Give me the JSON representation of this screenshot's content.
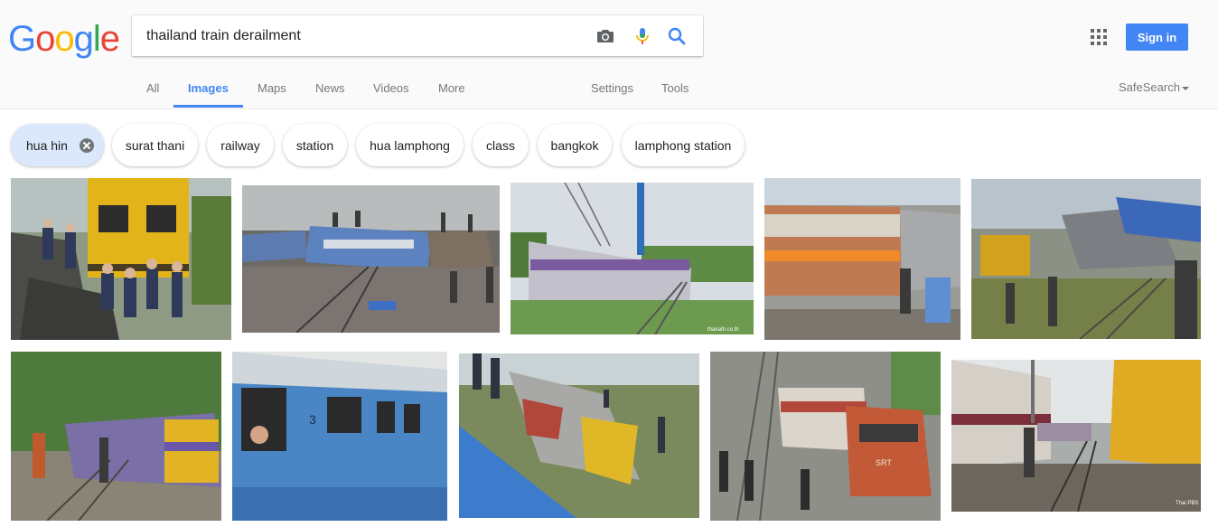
{
  "logo": {
    "letters": [
      "G",
      "o",
      "o",
      "g",
      "l",
      "e"
    ],
    "colors": [
      "#4285f4",
      "#ea4335",
      "#fbbc05",
      "#4285f4",
      "#34a853",
      "#ea4335"
    ]
  },
  "search": {
    "query": "thailand train derailment",
    "camera_icon": "camera-icon",
    "mic_icon": "mic-icon",
    "search_icon": "search-icon"
  },
  "header": {
    "apps_icon": "apps-grid-icon",
    "sign_in_label": "Sign in",
    "accent": "#4285f4"
  },
  "tabs": {
    "all": "All",
    "images": "Images",
    "maps": "Maps",
    "news": "News",
    "videos": "Videos",
    "more": "More",
    "settings": "Settings",
    "tools": "Tools",
    "active": "Images"
  },
  "safesearch": {
    "label": "SafeSearch"
  },
  "chips": [
    {
      "label": "hua hin",
      "selected": true
    },
    {
      "label": "surat thani"
    },
    {
      "label": "railway"
    },
    {
      "label": "station"
    },
    {
      "label": "hua lamphong"
    },
    {
      "label": "class"
    },
    {
      "label": "bangkok"
    },
    {
      "label": "lamphong station"
    }
  ],
  "results": {
    "thumbnails": [
      {
        "subject": "yellow locomotive crash with crowd"
      },
      {
        "subject": "overturned blue carriages with crowd"
      },
      {
        "subject": "purple train and crane"
      },
      {
        "subject": "orange-striped carriage derailed"
      },
      {
        "subject": "crane lifting derailed train"
      },
      {
        "subject": "overturned purple carriage in jungle"
      },
      {
        "subject": "blue carriage with passengers"
      },
      {
        "subject": "overturned yellow locomotive aerial view"
      },
      {
        "subject": "red locomotive SRT derailment"
      },
      {
        "subject": "yellow crane at derailment"
      }
    ],
    "watermarks": {
      "t3": "thairath.co.th",
      "t10": "Thai PBS"
    },
    "loco_text": {
      "t9": "SRT"
    }
  }
}
